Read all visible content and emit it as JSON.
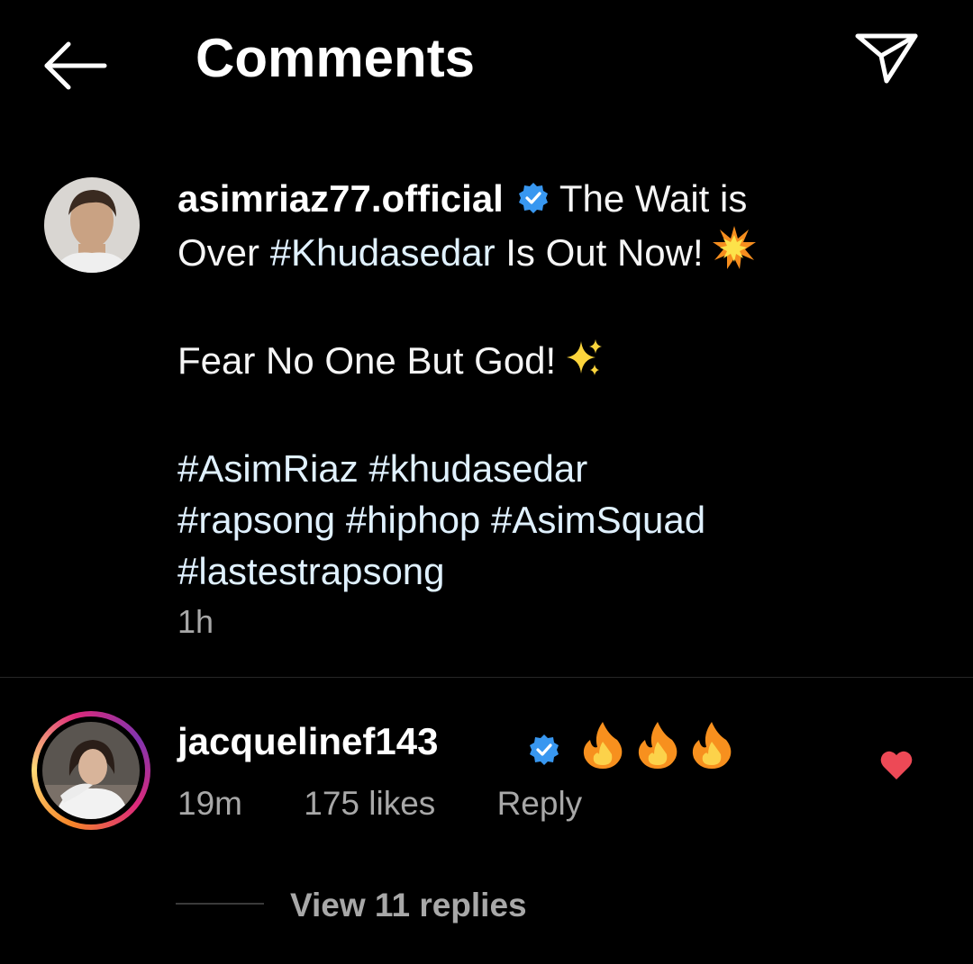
{
  "header": {
    "title": "Comments"
  },
  "post": {
    "username": "asimriaz77.official",
    "caption_line1": "The Wait is",
    "caption_line2_start": "Over",
    "caption_hashtag1": "#Khudasedar",
    "caption_line2_end": "Is Out Now!",
    "caption_line3": "Fear No One But God!",
    "hashtags": [
      "#AsimRiaz",
      "#khudasedar",
      "#rapsong",
      "#hiphop",
      "#AsimSquad",
      "#lastestrapsong"
    ],
    "time": "1h"
  },
  "comment": {
    "username": "jacquelinef143",
    "time": "19m",
    "likes": "175 likes",
    "reply_label": "Reply",
    "view_replies": "View 11 replies"
  },
  "colors": {
    "background": "#000000",
    "verified_badge": "#3897f0",
    "heart": "#ed4956",
    "muted_text": "#a8a8a8"
  }
}
